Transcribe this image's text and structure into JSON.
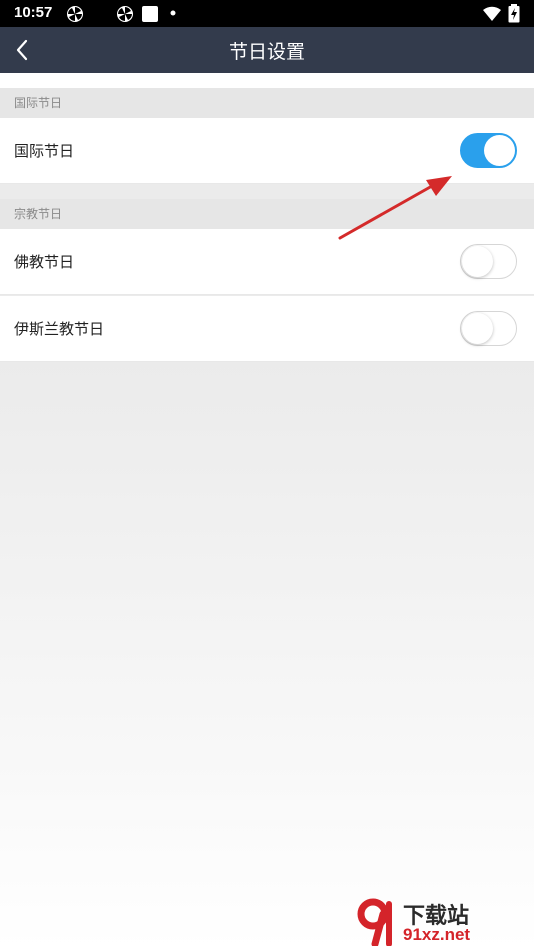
{
  "status_bar": {
    "time": "10:57"
  },
  "app_bar": {
    "title": "节日设置"
  },
  "sections": [
    {
      "header": "国际节日",
      "rows": [
        {
          "label": "国际节日",
          "enabled": true
        }
      ]
    },
    {
      "header": "宗教节日",
      "rows": [
        {
          "label": "佛教节日",
          "enabled": false
        },
        {
          "label": "伊斯兰教节日",
          "enabled": false
        }
      ]
    }
  ],
  "colors": {
    "app_bar": "#333b4c",
    "toggle_on": "#2aa0ec",
    "annotation_arrow": "#d42a2a"
  },
  "icons": {
    "back": "chevron-left-icon",
    "wifi": "wifi-icon",
    "battery": "battery-charging-icon",
    "notification": "pinwheel-icon",
    "arrow": "red-arrow-annotation"
  },
  "watermark": {
    "name": "下载站",
    "url": "91xz.net"
  }
}
